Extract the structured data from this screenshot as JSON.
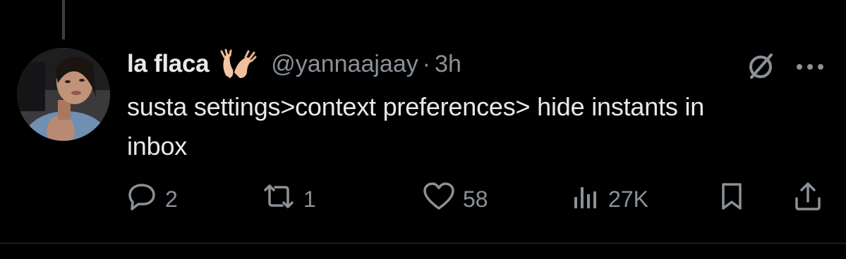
{
  "tweet": {
    "display_name": "la flaca",
    "handle": "@yannaajaay",
    "separator": "·",
    "time": "3h",
    "emoji_icon": "peach-hands-emoji-icon",
    "text": "susta settings>context preferences> hide instants in inbox"
  },
  "actions": {
    "reply_count": "2",
    "retweet_count": "1",
    "like_count": "58",
    "views_count": "27K"
  },
  "colors": {
    "background": "#000000",
    "text": "#e7e9ea",
    "muted": "#8b9197",
    "divider": "#2f3336"
  }
}
